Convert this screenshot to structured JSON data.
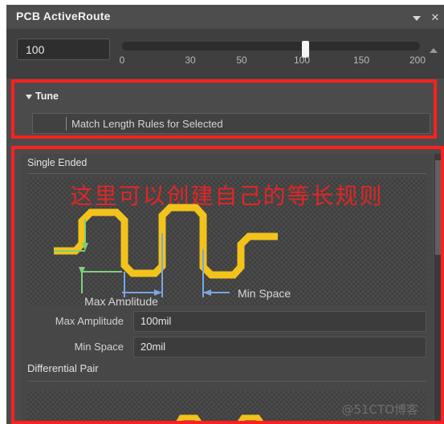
{
  "window": {
    "title": "PCB ActiveRoute",
    "caret_icon": "chevron-down-icon",
    "close_icon": "close-icon",
    "close_glyph": "✕"
  },
  "slider": {
    "value": "100",
    "ticks": [
      "0",
      "30",
      "50",
      "100",
      "150",
      "200"
    ],
    "tick_positions_pct": [
      0,
      23,
      40,
      60,
      78,
      98
    ],
    "thumb_value": 100,
    "min": 0,
    "max": 200,
    "scroll_up_icon": "scroll-up-arrow-icon"
  },
  "tune": {
    "collapse_icon": "triangle-collapse-icon",
    "label": "Tune",
    "match_length_button": "Match Length Rules for Selected"
  },
  "single_ended": {
    "title": "Single Ended",
    "annotation_cn": "这里可以创建自己的等长规则",
    "diagram": {
      "trace_color": "#f2c31a",
      "amplitude_arrow_color": "#7ccf7c",
      "space_arrow_color": "#7aa8dd",
      "label_max_amplitude": "Max Amplitude",
      "label_min_space": "Min Space"
    },
    "fields": [
      {
        "label": "Max Amplitude",
        "value": "100mil"
      },
      {
        "label": "Min Space",
        "value": "20mil"
      }
    ]
  },
  "differential_pair": {
    "title": "Differential Pair"
  },
  "watermark": "@51CTO博客",
  "colors": {
    "highlight_red": "#fd2020",
    "panel_bg": "#4b4b4b",
    "titlebar_bg": "#4d4d4d",
    "accent_trace": "#f2c31a"
  }
}
